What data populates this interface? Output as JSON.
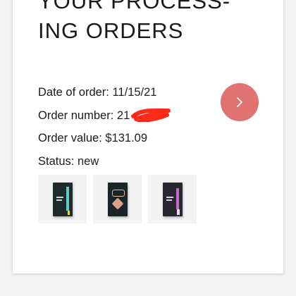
{
  "title": {
    "line1": "YOUR PROCESS-",
    "line2": "ING ORDERS"
  },
  "order": {
    "date_label": "Date of order:",
    "date_value": "11/15/21",
    "number_label": "Order number:",
    "number_value": "21",
    "value_label": "Order value:",
    "value_value": "$131.09",
    "status_label": "Status:",
    "status_value": "new"
  },
  "icons": {
    "details_button": "chevron-right-icon"
  },
  "colors": {
    "accent": "#e07272",
    "redaction": "#ff2a1a"
  },
  "products": [
    {
      "name": "product-1",
      "box_color": "#1f2a2a",
      "accent_color": "#5fd1c4"
    },
    {
      "name": "product-2",
      "box_color": "#1b2528",
      "accent_color": "#e6b9a8"
    },
    {
      "name": "product-3",
      "box_color": "#2a2630",
      "accent_color": "#c06acb"
    }
  ]
}
